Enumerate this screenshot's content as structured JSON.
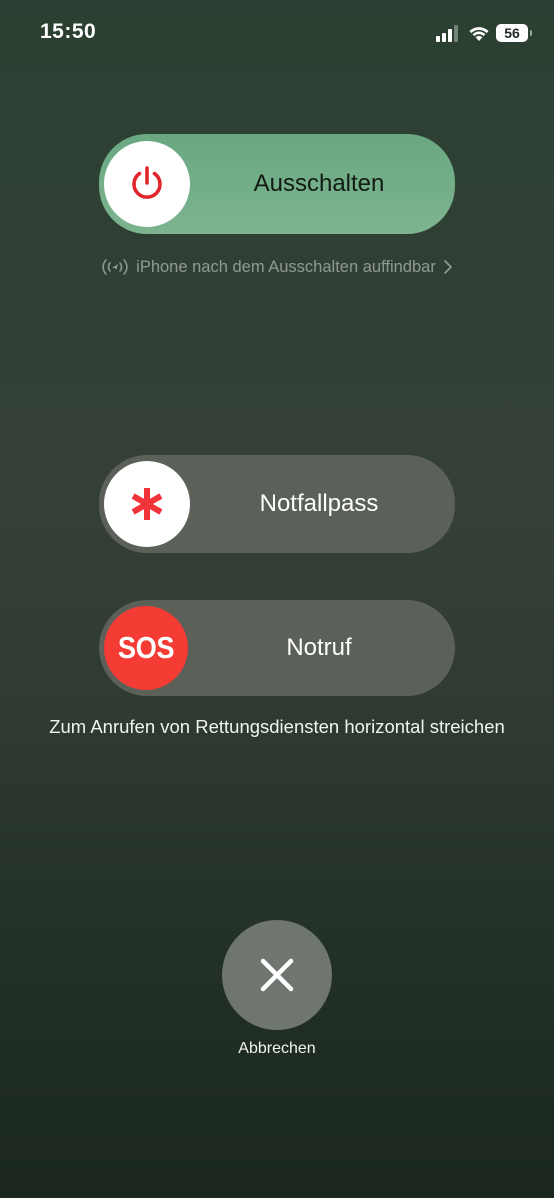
{
  "status_bar": {
    "time": "15:50",
    "battery_level": "56",
    "icons": [
      "signal-icon",
      "wifi-icon",
      "battery-icon"
    ]
  },
  "power_slider": {
    "label": "Ausschalten",
    "icon": "power-icon",
    "icon_color": "#e0262b",
    "track_color": "#6aa882"
  },
  "find_my": {
    "text": "iPhone nach dem Ausschalten auffindbar",
    "icon": "find-my-icon",
    "chevron": "chevron-right-icon"
  },
  "medical_id_slider": {
    "label": "Notfallpass",
    "icon": "medical-asterisk-icon",
    "icon_color": "#f0343a"
  },
  "sos_slider": {
    "label": "Notruf",
    "knob_text": "SOS",
    "knob_color": "#f43b34"
  },
  "sos_hint": "Zum Anrufen von Rettungsdiensten horizontal streichen",
  "cancel": {
    "label": "Abbrechen",
    "icon": "close-icon"
  }
}
